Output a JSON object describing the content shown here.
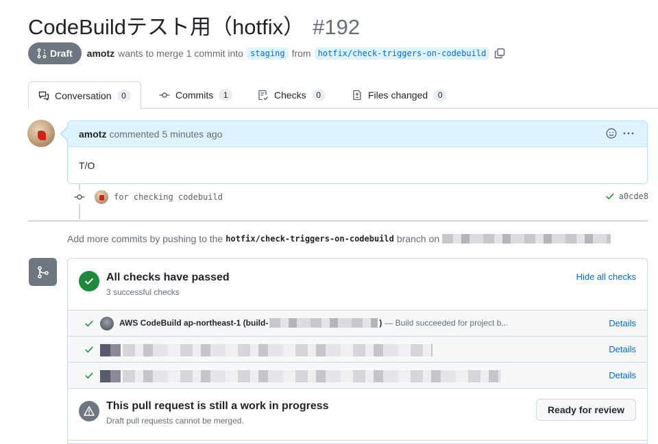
{
  "pr": {
    "title": "CodeBuildテスト用（hotfix）",
    "number": "#192",
    "state": "Draft",
    "author": "amotz",
    "merge_text": "wants to merge 1 commit into",
    "base_branch": "staging",
    "from_text": "from",
    "head_branch": "hotfix/check-triggers-on-codebuild"
  },
  "tabs": [
    {
      "label": "Conversation",
      "count": "0",
      "icon": "comment-discussion-icon"
    },
    {
      "label": "Commits",
      "count": "1",
      "icon": "git-commit-icon"
    },
    {
      "label": "Checks",
      "count": "0",
      "icon": "checklist-icon"
    },
    {
      "label": "Files changed",
      "count": "0",
      "icon": "file-diff-icon"
    }
  ],
  "comment": {
    "author": "amotz",
    "meta": "commented 5 minutes ago",
    "body": "T/O"
  },
  "commit": {
    "message": "for checking codebuild",
    "sha": "a0cde8"
  },
  "hint": {
    "prefix": "Add more commits by pushing to the",
    "branch": "hotfix/check-triggers-on-codebuild",
    "suffix": "branch on"
  },
  "checks": {
    "title": "All checks have passed",
    "subtitle": "3 successful checks",
    "hide_label": "Hide all checks",
    "items": [
      {
        "name": "AWS CodeBuild ap-northeast-1 (build-",
        "name_tail": ")",
        "desc": "— Build succeeded for project b...",
        "details": "Details"
      },
      {
        "details": "Details"
      },
      {
        "details": "Details"
      }
    ]
  },
  "wip": {
    "title": "This pull request is still a work in progress",
    "subtitle": "Draft pull requests cannot be merged.",
    "button": "Ready for review"
  },
  "colors": {
    "accent": "#0969da",
    "success": "#1f883d",
    "draft": "#6e7781",
    "comment_header": "#ddf4ff"
  }
}
